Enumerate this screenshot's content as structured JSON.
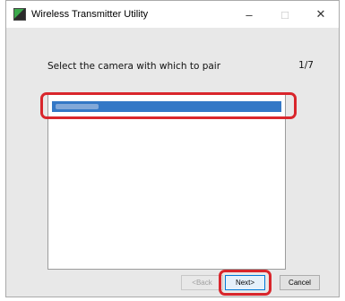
{
  "window": {
    "title": "Wireless Transmitter Utility",
    "icon": "camera-app-icon",
    "controls": {
      "minimize": "–",
      "maximize": "□",
      "close": "✕"
    }
  },
  "dialog": {
    "heading": "Select the camera with which to pair",
    "step": "1/7"
  },
  "camera_list": {
    "items": [
      {
        "label": "",
        "selected": true
      }
    ]
  },
  "buttons": {
    "back": "<Back",
    "next": "Next>",
    "cancel": "Cancel"
  },
  "colors": {
    "highlight": "#d9262c",
    "selection": "#3478c6"
  }
}
